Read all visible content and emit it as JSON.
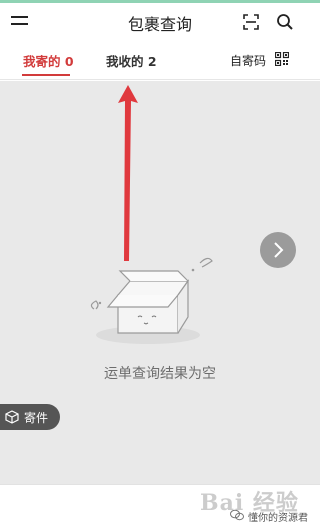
{
  "header": {
    "title": "包裹查询"
  },
  "tabs": [
    {
      "label": "我寄的 0",
      "active": true
    },
    {
      "label": "我收的 2",
      "active": false
    }
  ],
  "self_code_label": "自寄码",
  "empty_state": {
    "message": "运单查询结果为空"
  },
  "fab": {
    "label": "寄件"
  },
  "watermark": {
    "logo": "Bai 经验",
    "account": "懂你的资源君"
  },
  "colors": {
    "accent": "#d23b3b",
    "content_bg": "#e9e9e9",
    "top_strip": "#8fd3b4"
  },
  "icons": {
    "menu": "menu-icon",
    "scan": "scan-icon",
    "search": "search-icon",
    "qr": "qr-code-icon",
    "next": "chevron-right-icon",
    "send": "cube-icon",
    "annotation": "red-arrow-up"
  }
}
